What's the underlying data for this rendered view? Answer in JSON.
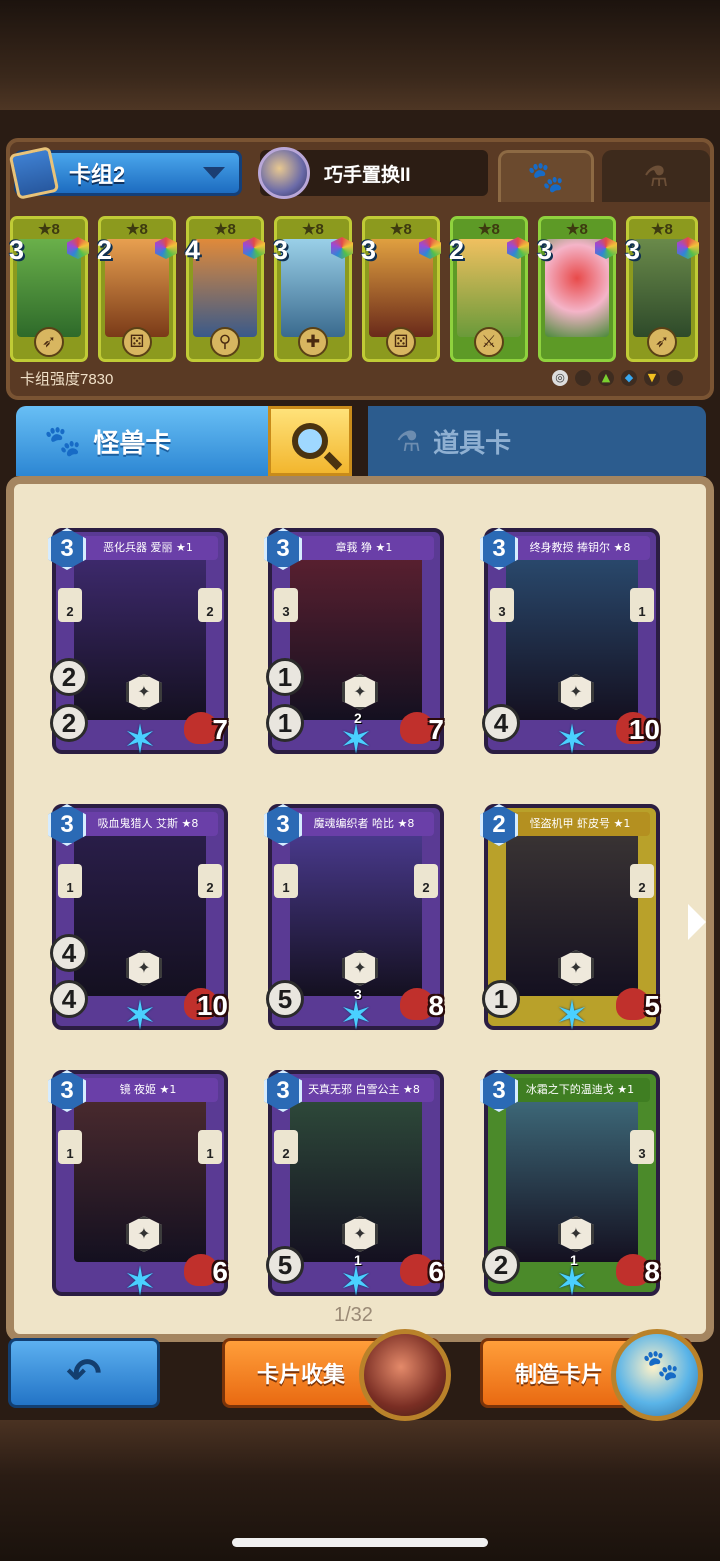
{
  "deck": {
    "name": "卡组2",
    "skill": "巧手置换II",
    "strength": "卡组强度7830",
    "cards": [
      {
        "cost": "3",
        "star": "★8",
        "color": "#3f8a3c",
        "icon": "bow"
      },
      {
        "cost": "2",
        "star": "★8",
        "color": "#c06a2a",
        "icon": "dice"
      },
      {
        "cost": "4",
        "star": "★8",
        "color": "#b8561a",
        "icon": "hook"
      },
      {
        "cost": "3",
        "star": "★8",
        "color": "#5d8fb8",
        "icon": "cross"
      },
      {
        "cost": "3",
        "star": "★8",
        "color": "#a8482a",
        "icon": "dice"
      },
      {
        "cost": "2",
        "star": "★8",
        "color": "#8bb84a",
        "icon": "sword"
      },
      {
        "cost": "3",
        "star": "★8",
        "color": "#c04070",
        "icon": ""
      },
      {
        "cost": "3",
        "star": "★8",
        "color": "#4a7a3a",
        "icon": "bow"
      }
    ]
  },
  "tabs": {
    "monster": "怪兽卡",
    "item": "道具卡"
  },
  "collection": {
    "page": "1/32",
    "cards": [
      {
        "name": "恶化兵器 爱丽 ★1",
        "cost": "3",
        "left": "2",
        "right": "2",
        "stat2": "2",
        "atk": "2",
        "hp": "7",
        "ability": "",
        "frame": "purple",
        "art": "#3e2a6e"
      },
      {
        "name": "章莪 狰 ★1",
        "cost": "3",
        "left": "3",
        "right": "",
        "stat2": "1",
        "atk": "1",
        "hp": "7",
        "ability": "2",
        "frame": "purple",
        "art": "#5a2030"
      },
      {
        "name": "终身教授 捧钥尔 ★8",
        "cost": "3",
        "left": "3",
        "right": "1",
        "stat2": "",
        "atk": "4",
        "hp": "10",
        "ability": "",
        "frame": "purple",
        "art": "#2a4a6e"
      },
      {
        "name": "吸血鬼猎人 艾斯 ★8",
        "cost": "3",
        "left": "1",
        "right": "2",
        "stat2": "4",
        "atk": "4",
        "hp": "10",
        "ability": "",
        "frame": "purple",
        "art": "#2a1e4a"
      },
      {
        "name": "魔魂编织者 哈比 ★8",
        "cost": "3",
        "left": "1",
        "right": "2",
        "stat2": "",
        "atk": "5",
        "hp": "8",
        "ability": "3",
        "frame": "purple",
        "art": "#4a3a8e"
      },
      {
        "name": "怪盗机甲 虾皮号 ★1",
        "cost": "2",
        "left": "",
        "right": "2",
        "stat2": "",
        "atk": "1",
        "hp": "5",
        "ability": "",
        "frame": "yellow",
        "art": "#3a3434"
      },
      {
        "name": "镜 夜姬 ★1",
        "cost": "3",
        "left": "1",
        "right": "1",
        "stat2": "",
        "atk": "",
        "hp": "6",
        "ability": "",
        "frame": "purple",
        "art": "#4a2a2e"
      },
      {
        "name": "天真无邪 白雪公主 ★8",
        "cost": "3",
        "left": "2",
        "right": "",
        "stat2": "",
        "atk": "5",
        "hp": "6",
        "ability": "1",
        "frame": "purple",
        "art": "#2e4a3a"
      },
      {
        "name": "冰霜之下的温迪戈 ★1",
        "cost": "3",
        "left": "",
        "right": "3",
        "stat2": "",
        "atk": "2",
        "hp": "8",
        "ability": "1",
        "frame": "green",
        "art": "#3e6a7a"
      }
    ]
  },
  "buttons": {
    "collect": "卡片收集",
    "craft": "制造卡片"
  }
}
